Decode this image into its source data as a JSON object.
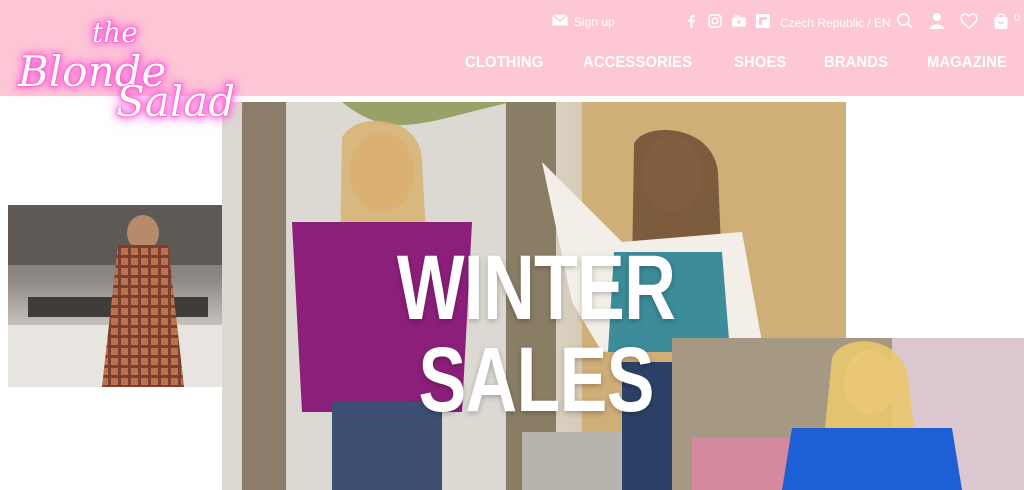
{
  "brand": {
    "logo_line1": "the",
    "logo_line2": "Blonde",
    "logo_line3": "Salad"
  },
  "topbar": {
    "signup_label": "Sign up",
    "social_icons": [
      "facebook-icon",
      "instagram-icon",
      "youtube-icon",
      "flipboard-icon"
    ],
    "country_label": "Czech Republic / EN",
    "cart_count": "0"
  },
  "nav": {
    "items": [
      {
        "label": "CLOTHING"
      },
      {
        "label": "ACCESSORIES"
      },
      {
        "label": "SHOES"
      },
      {
        "label": "BRANDS"
      },
      {
        "label": "MAGAZINE"
      }
    ]
  },
  "hero": {
    "title": "WINTER SALES"
  },
  "colors": {
    "header_bg": "#fdc7d6",
    "logo_glow": "#ff4fd0",
    "nav_text": "#ffffff"
  }
}
